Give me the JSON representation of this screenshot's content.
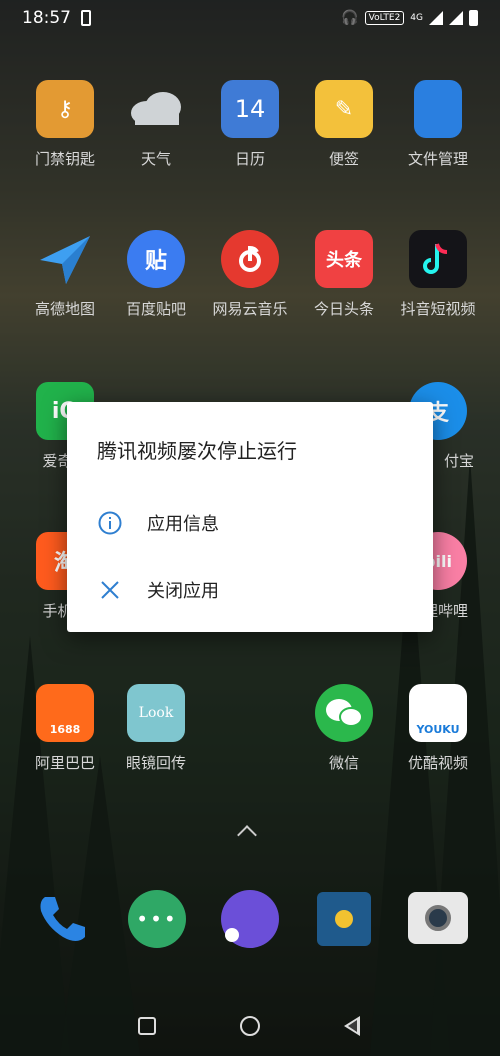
{
  "status_bar": {
    "time": "18:57",
    "network": "VoLTE2",
    "net_gen": "4G"
  },
  "apps": [
    {
      "label": "门禁钥匙",
      "icon": "key-icon",
      "color": "#e39a33"
    },
    {
      "label": "天气",
      "icon": "cloud-icon",
      "color": "#cfd3d6"
    },
    {
      "label": "日历",
      "icon_text": "14",
      "icon": "calendar-icon",
      "color": "#3f7bd6"
    },
    {
      "label": "便签",
      "icon": "pencil-note-icon",
      "color": "#f3c13b"
    },
    {
      "label": "文件管理",
      "icon": "folder-icon",
      "color": "#2a7fe0"
    },
    {
      "label": "高德地图",
      "icon": "paper-plane-icon",
      "color": "#3e9ff1"
    },
    {
      "label": "百度贴吧",
      "icon_text": "贴",
      "icon": "tieba-icon",
      "color": "#3b7cf1"
    },
    {
      "label": "网易云音乐",
      "icon": "netease-music-icon",
      "color": "#e5392f"
    },
    {
      "label": "今日头条",
      "icon_text": "头条",
      "icon": "toutiao-icon",
      "color": "#f04142"
    },
    {
      "label": "抖音短视频",
      "icon": "tiktok-icon",
      "color": "#141418"
    },
    {
      "label": "爱奇艺",
      "icon_text": "iQ",
      "icon": "iqiyi-icon",
      "color": "#21b24b"
    },
    {
      "label": "付宝",
      "icon_text": "支",
      "icon": "alipay-icon",
      "color": "#1b8ee9"
    },
    {
      "label": "手机淘",
      "icon_text": "淘",
      "icon": "taobao-icon",
      "color": "#ff5b1e"
    },
    {
      "label": "哔哩哔哩",
      "icon_text": "bili",
      "icon": "bilibili-icon",
      "color": "#fa7fa5"
    },
    {
      "label": "阿里巴巴",
      "icon_text": "1688",
      "icon": "alibaba-icon",
      "color": "#ff6a1b"
    },
    {
      "label": "眼镜回传",
      "icon_text": "Look",
      "icon": "look-icon",
      "color": "#7fc6cf"
    },
    {
      "label": "微信",
      "icon": "wechat-icon",
      "color": "#2bb84c"
    },
    {
      "label": "优酷视频",
      "icon_text": "YOUKU",
      "icon": "youku-icon",
      "color": "#ffffff"
    }
  ],
  "dock": [
    {
      "icon": "phone-icon",
      "color": "#2b84e3"
    },
    {
      "icon": "messages-icon",
      "color": "#2fa866"
    },
    {
      "icon": "browser-icon",
      "color": "#6b4fd8"
    },
    {
      "icon": "gallery-icon",
      "color": "#1f5a8c"
    },
    {
      "icon": "camera-icon",
      "color": "#e8e8e8"
    }
  ],
  "dialog": {
    "title": "腾讯视频屡次停止运行",
    "options": [
      {
        "label": "应用信息",
        "icon": "info-icon"
      },
      {
        "label": "关闭应用",
        "icon": "close-icon"
      }
    ],
    "accent": "#2f7fd0"
  }
}
